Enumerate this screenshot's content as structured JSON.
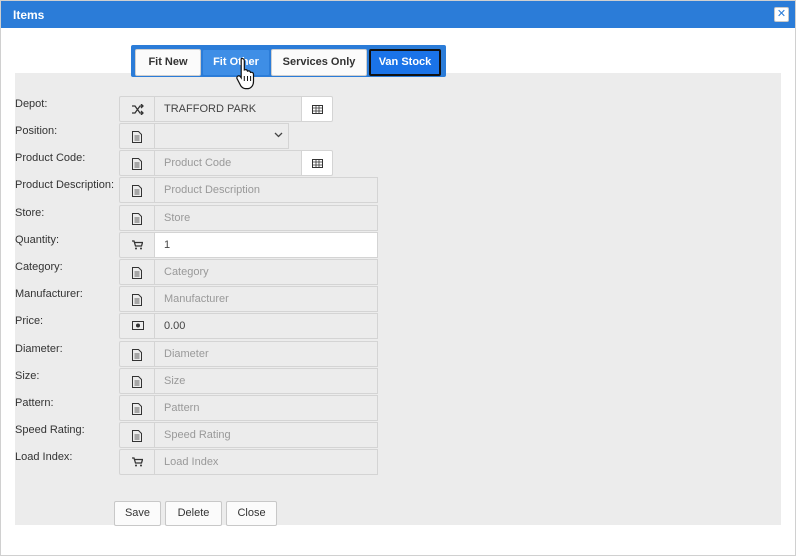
{
  "dialog": {
    "title": "Items"
  },
  "tabs": [
    {
      "label": "Fit New"
    },
    {
      "label": "Fit Other"
    },
    {
      "label": "Services Only"
    },
    {
      "label": "Van Stock"
    }
  ],
  "form": {
    "depot": {
      "label": "Depot:",
      "value": "TRAFFORD PARK"
    },
    "position": {
      "label": "Position:",
      "value": ""
    },
    "product_code": {
      "label": "Product Code:",
      "placeholder": "Product Code"
    },
    "product_desc": {
      "label": "Product Description:",
      "placeholder": "Product Description"
    },
    "store": {
      "label": "Store:",
      "placeholder": "Store"
    },
    "quantity": {
      "label": "Quantity:",
      "value": "1"
    },
    "category": {
      "label": "Category:",
      "placeholder": "Category"
    },
    "manufacturer": {
      "label": "Manufacturer:",
      "placeholder": "Manufacturer"
    },
    "price": {
      "label": "Price:",
      "value": "0.00"
    },
    "diameter": {
      "label": "Diameter:",
      "placeholder": "Diameter"
    },
    "size": {
      "label": "Size:",
      "placeholder": "Size"
    },
    "pattern": {
      "label": "Pattern:",
      "placeholder": "Pattern"
    },
    "speed_rating": {
      "label": "Speed Rating:",
      "placeholder": "Speed Rating"
    },
    "load_index": {
      "label": "Load Index:",
      "placeholder": "Load Index"
    }
  },
  "buttons": {
    "save": "Save",
    "delete": "Delete",
    "close": "Close"
  },
  "colors": {
    "titlebar": "#2b7cd8",
    "active_tab": "#1a73e8",
    "panel": "#ececec"
  },
  "icons": [
    "shuffle-icon",
    "document-icon",
    "cart-icon",
    "money-icon",
    "grid-icon",
    "chevron-down-icon",
    "close-icon",
    "hand-pointer-icon"
  ]
}
